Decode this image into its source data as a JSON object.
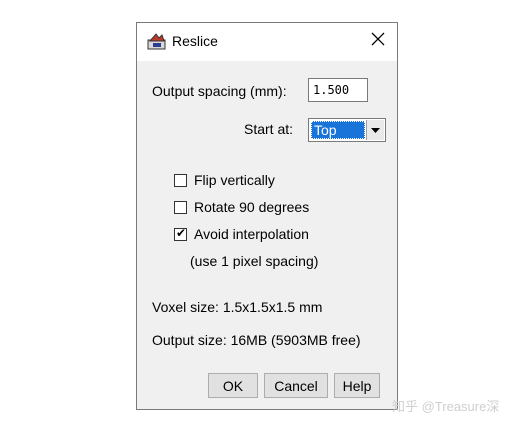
{
  "window": {
    "title": "Reslice",
    "icon": "imagej-icon",
    "close_icon": "close-icon"
  },
  "form": {
    "output_spacing_label": "Output spacing (mm):",
    "output_spacing_value": "1.500",
    "start_at_label": "Start at:",
    "start_at_value": "Top",
    "dropdown_icon": "chevron-down-icon"
  },
  "options": [
    {
      "label": "Flip vertically",
      "checked": false
    },
    {
      "label": "Rotate 90 degrees",
      "checked": false
    },
    {
      "label": "Avoid interpolation",
      "checked": true
    }
  ],
  "interpolation_note": "(use 1 pixel spacing)",
  "info": {
    "voxel_size": "Voxel size: 1.5x1.5x1.5 mm",
    "output_size": "Output size: 16MB (5903MB free)"
  },
  "buttons": {
    "ok": "OK",
    "cancel": "Cancel",
    "help": "Help"
  },
  "watermark": "知乎 @Treasure深"
}
